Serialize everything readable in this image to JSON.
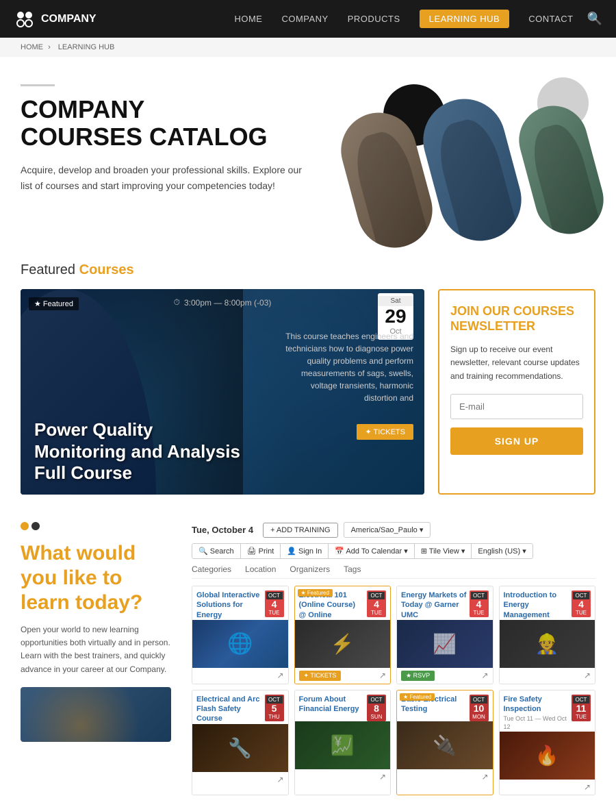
{
  "nav": {
    "logo_text": "COMPANY",
    "links": [
      {
        "label": "HOME",
        "key": "home"
      },
      {
        "label": "COMPANY",
        "key": "company"
      },
      {
        "label": "PRODUCTS",
        "key": "products"
      },
      {
        "label": "LEARNING HUB",
        "key": "learning-hub",
        "active": true
      },
      {
        "label": "CONTACT",
        "key": "contact"
      }
    ]
  },
  "breadcrumb": {
    "home": "HOME",
    "separator": "›",
    "current": "LEARNING HUB"
  },
  "hero": {
    "accent": "COMPANY",
    "title": "COMPANY\nCOURSES CATALOG",
    "description": "Acquire, develop and broaden your professional skills. Explore our list of courses and start improving your competencies today!"
  },
  "featured_section": {
    "prefix": "Featured",
    "suffix": "Courses",
    "card": {
      "badge": "Featured",
      "time": "3:00pm — 8:00pm (-03)",
      "date_day_name": "Sat",
      "date_day": "29",
      "date_month": "Oct",
      "description": "This course teaches engineers and technicians how to diagnose power quality problems and perform measurements of sags, swells, voltage transients, harmonic distortion and",
      "tickets_label": "✦ TICKETS",
      "title": "Power Quality\nMonitoring and Analysis\nFull Course"
    },
    "newsletter": {
      "title": "JOIN OUR COURSES\nNEWSLETTER",
      "description": "Sign up to receive our event newsletter, relevant course updates and training recommendations.",
      "email_placeholder": "E-mail",
      "signup_label": "SIGN UP"
    }
  },
  "calendar": {
    "date_label": "Tue, October 4",
    "add_training_label": "+ ADD TRAINING",
    "timezone_label": "America/Sao_Paulo ▾",
    "toolbar_buttons": [
      "🔍 Search",
      "🖨 Print",
      "👤 Sign In",
      "📅 Add To Calendar ▾",
      "⊞ Tile View ▾",
      "English (US) ▾"
    ],
    "filters": [
      "Categories",
      "Location",
      "Organizers",
      "Tags"
    ],
    "what_learn": {
      "title": "What would\nyou like to\nlearn today?",
      "description": "Open your world to new learning opportunities both virtually and in person. Learn with the best trainers, and quickly advance in your career at our Company."
    }
  },
  "events_row1": [
    {
      "title": "Global Interactive Solutions for Energy",
      "date_month": "OCT",
      "date_day": "4",
      "date_day_short": "TUE",
      "thumb_class": "thumb-globe",
      "action": "share",
      "featured": false
    },
    {
      "title": "Electrical 101 (Online Course) @ Online",
      "date_month": "OCT",
      "date_day": "4",
      "date_day_short": "TUE",
      "thumb_class": "thumb-elec",
      "action": "tickets",
      "action_label": "TICKETS",
      "featured": true
    },
    {
      "title": "Energy Markets of Today @ Garner UMC",
      "date_month": "OCT",
      "date_day": "4",
      "date_day_short": "TUE",
      "thumb_class": "thumb-energy",
      "action": "rsvp",
      "action_label": "RSVP",
      "featured": false
    },
    {
      "title": "Introduction to Energy Management",
      "date_month": "OCT",
      "date_day": "4",
      "date_day_short": "TUE",
      "thumb_class": "thumb-mgmt",
      "action": "share",
      "featured": false
    }
  ],
  "events_row2": [
    {
      "title": "Electrical and Arc Flash Safety Course",
      "date_month": "OCT",
      "date_day": "5",
      "date_day_short": "THU",
      "thumb_class": "thumb-safety",
      "action": "share",
      "featured": false
    },
    {
      "title": "Forum About Financial Energy",
      "date_month": "OCT",
      "date_day": "8",
      "date_day_short": "SUN",
      "thumb_class": "thumb-finance",
      "action": "share",
      "featured": false
    },
    {
      "title": "Basic Electrical Testing",
      "date_month": "OCT",
      "date_day": "10",
      "date_day_short": "MON",
      "thumb_class": "thumb-basic",
      "action": "share",
      "featured": true
    },
    {
      "title": "Fire Safety Inspection",
      "date_month": "OCT",
      "date_day": "11",
      "date_day_short": "TUE",
      "date_sub": "Tue Oct 11 — Wed Oct 12",
      "thumb_class": "thumb-fire",
      "action": "share",
      "featured": false
    }
  ]
}
